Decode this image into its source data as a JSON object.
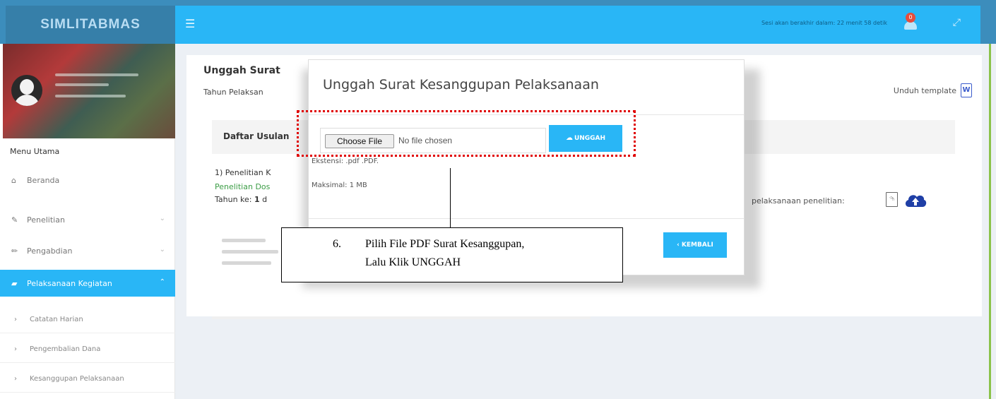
{
  "topbar": {
    "brand": "SIMLITABMAS",
    "menu_icon": "hamburger-icon",
    "session_text": "Sesi akan berakhir dalam: 22 menit 58 detik",
    "notification_count": "0",
    "fullscreen_icon": "expand-icon"
  },
  "sidebar": {
    "menu_title": "Menu Utama",
    "items": [
      {
        "label": "Beranda",
        "icon": "home-icon"
      },
      {
        "label": "Penelitian",
        "icon": "edit-icon"
      },
      {
        "label": "Pengabdian",
        "icon": "pencil-icon"
      },
      {
        "label": "Pelaksanaan Kegiatan",
        "icon": "book-icon"
      }
    ],
    "sub_items": [
      {
        "label": "Catatan Harian"
      },
      {
        "label": "Pengembalian Dana"
      },
      {
        "label": "Kesanggupan Pelaksanaan"
      }
    ]
  },
  "main": {
    "page_title": "Unggah Surat",
    "tahun_label": "Tahun Pelaksan",
    "unduh_label": "Unduh template",
    "word_icon_text": "W",
    "daftar_title": "Daftar Usulan",
    "item_num": "1) Penelitian K",
    "item_green": "Penelitian Dos",
    "item_tahun_prefix": "Tahun ke:",
    "item_tahun_value": "1",
    "item_tahun_suffix": "d",
    "pelaksanaan_text": "pelaksanaan penelitian:",
    "pdf_icon_text": "⮲"
  },
  "modal": {
    "title": "Unggah Surat Kesanggupan Pelaksanaan",
    "choose_file": "Choose File",
    "no_file": "No file chosen",
    "unggah": "UNGGAH",
    "ekstensi": "Ekstensi: .pdf .PDF.",
    "maksimal": "Maksimal: 1 MB",
    "kembali": "KEMBALI"
  },
  "annotation": {
    "number": "6.",
    "line1": "Pilih File PDF Surat Kesanggupan,",
    "line2": "Lalu Klik UNGGAH"
  },
  "colors": {
    "topbar": "#29b6f6",
    "active_nav": "#29b6f6",
    "dotted_highlight": "#e00000",
    "green_text": "#3c9d46"
  }
}
